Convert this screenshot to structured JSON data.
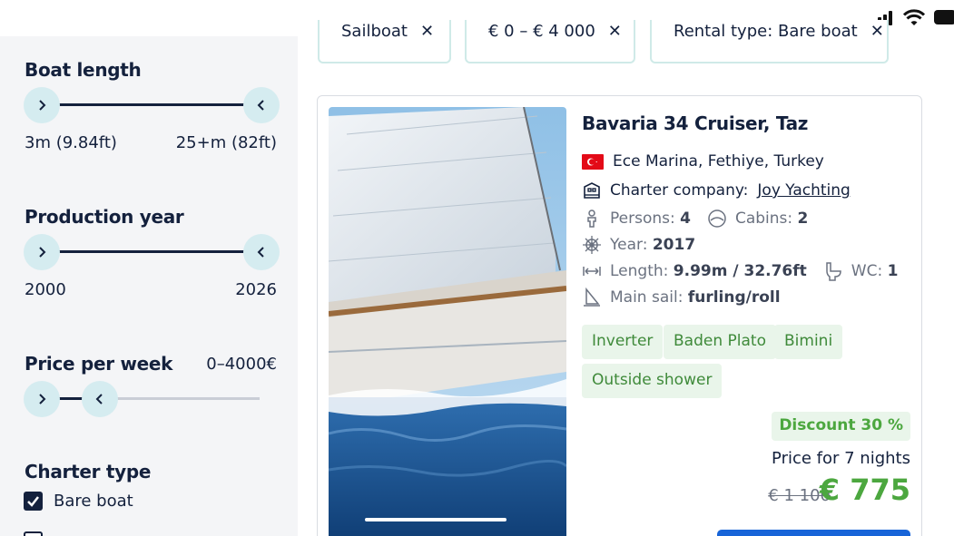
{
  "filters": {
    "chips": [
      {
        "label": "Sailboat"
      },
      {
        "label": "€ 0 – € 4 000"
      },
      {
        "label": "Rental type: Bare boat"
      }
    ]
  },
  "sidebar": {
    "boat_length": {
      "title": "Boat length",
      "min_label": "3m (9.84ft)",
      "max_label": "25+m (82ft)"
    },
    "production_year": {
      "title": "Production year",
      "min_label": "2000",
      "max_label": "2026"
    },
    "price_per_week": {
      "title": "Price per week",
      "value_label": "0–4000€"
    },
    "charter_type": {
      "title": "Charter type",
      "options": [
        {
          "label": "Bare boat",
          "checked": true
        }
      ]
    }
  },
  "listing": {
    "title": "Bavaria 34 Cruiser, Taz",
    "location": "Ece Marina, Fethiye, Turkey",
    "charter_company_label": "Charter company:",
    "charter_company": "Joy Yachting",
    "persons_label": "Persons:",
    "persons": "4",
    "cabins_label": "Cabins:",
    "cabins": "2",
    "year_label": "Year:",
    "year": "2017",
    "length_label": "Length:",
    "length": "9.99m / 32.76ft",
    "wc_label": "WC:",
    "wc": "1",
    "mainsail_label": "Main sail:",
    "mainsail": "furling/roll",
    "tags": [
      "Inverter",
      "Baden Plato",
      "Bimini",
      "Outside shower"
    ],
    "discount": "Discount 30 %",
    "price_label": "Price for 7 nights",
    "old_price": "€ 1 100",
    "new_price": "€ 775"
  },
  "colors": {
    "primary": "#14213d",
    "accent_green": "#4ca73f",
    "knob_bg": "#d5ecf0",
    "cta_blue": "#1764d8"
  },
  "icons": [
    "signal-icon",
    "wifi-icon",
    "battery-icon",
    "chevron-right-icon",
    "chevron-left-icon",
    "close-icon",
    "checkbox-checked-icon",
    "turkey-flag-icon",
    "building-icon",
    "person-icon",
    "bed-icon",
    "helm-icon",
    "length-icon",
    "toilet-icon",
    "sail-icon"
  ]
}
